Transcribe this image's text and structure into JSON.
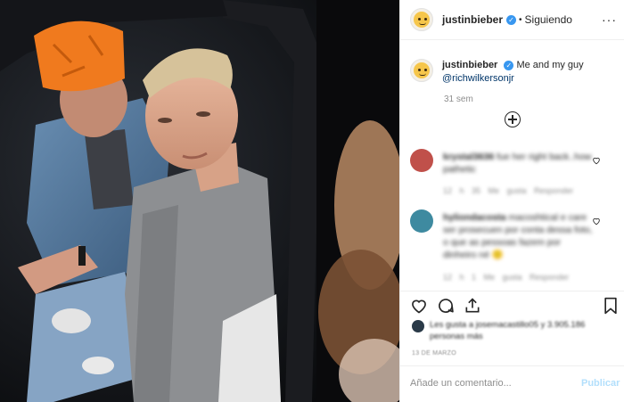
{
  "header": {
    "username": "justinbieber",
    "verified_mark": "✓",
    "separator": "•",
    "follow_status": "Siguiendo",
    "more_glyph": "···"
  },
  "caption": {
    "username": "justinbieber",
    "text": "Me and my guy",
    "mention": "@richwilkersonjr",
    "age": "31 sem"
  },
  "comments": [
    {
      "username": "krystal3636",
      "text": "fue her right back..how pathetic",
      "meta": "12 h   35 Me gusta   Responder",
      "avatar_color": "#c0504a"
    },
    {
      "username": "hyliondacosta",
      "text": "macoshtical e care ser prosecuen por conta dessa foto, o que as pessoas fazem por dinheiro né",
      "emoji": "🙂",
      "meta": "12 h   1 Me gusta   Responder",
      "avatar_color": "#3e8aa0"
    }
  ],
  "likes": {
    "text": "Les gusta a josemacastillo05 y 3.905.186 personas más"
  },
  "date": "13 DE MARZO",
  "comment_box": {
    "placeholder": "Añade un comentario...",
    "publish_label": "Publicar"
  },
  "colors": {
    "link": "#003569",
    "muted": "#8e8e8e",
    "verified": "#3897f0",
    "publish_disabled": "#b2dffc",
    "cap": "#f07a1e"
  }
}
